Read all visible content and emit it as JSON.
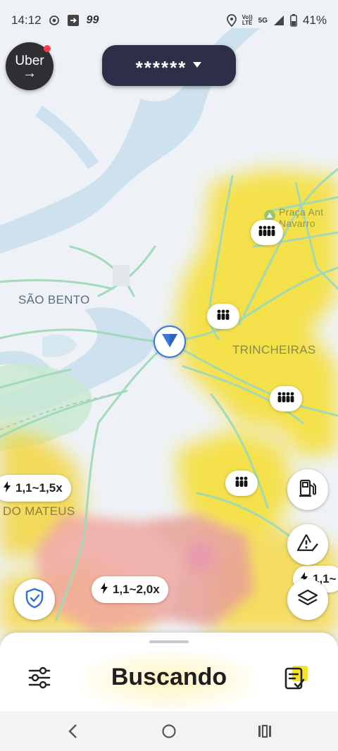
{
  "status_bar": {
    "time": "14:12",
    "carrier_badge": "99",
    "network_top": "Vo))",
    "network_bottom": "LTE",
    "signal_type": "5G",
    "battery": "41%"
  },
  "header": {
    "app_badge_line1": "Uber",
    "app_badge_line2": "→",
    "earnings_masked": "******"
  },
  "map": {
    "labels": {
      "neighborhood_1": "SÃO BENTO",
      "neighborhood_2": "TRINCHEIRAS",
      "neighborhood_3": "DO MATEUS",
      "poi": "Praça Antenor Navarro"
    },
    "poi_line1": "Praça Ant",
    "poi_line2": "Navarro",
    "surge_zones": [
      {
        "multiplier": "1,1~1,5x"
      },
      {
        "multiplier": "1,1~2,0x"
      },
      {
        "multiplier": "1,1~"
      }
    ],
    "colors": {
      "demand_high": "#f7e146",
      "surge_hot": "#f1a8a1",
      "surge_warm": "#f6c8a8",
      "water": "#cfe2ee",
      "road": "#9fd9b8",
      "accent_blue": "#3a78d8"
    },
    "icons": {
      "crowd": "crowd-icon",
      "location": "navigation-arrow-icon",
      "fuel": "fuel-pump-icon",
      "alert": "warning-icon",
      "layers": "layers-icon",
      "safety": "shield-check-icon"
    }
  },
  "bottom_sheet": {
    "status": "Buscando"
  }
}
